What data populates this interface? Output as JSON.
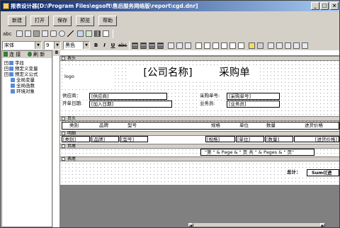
{
  "window": {
    "title": "报表设计器[D:\\Program Files\\egsoft\\售后服务网络版\\report\\cgd.dnr]",
    "min_label": "_",
    "max_label": "□",
    "close_label": "×"
  },
  "toolbar": {
    "new": "新建",
    "open": "打开",
    "save": "保存",
    "preview": "预览",
    "help": "帮助"
  },
  "format": {
    "font": "宋体",
    "size": "9",
    "color": "黑色",
    "bold": "B",
    "italic": "I",
    "underline": "U",
    "strike": "abc"
  },
  "left": {
    "tab_connect": "连 接",
    "tab_refresh": "刷 新",
    "tree": [
      {
        "label": "字段",
        "pm": "+"
      },
      {
        "label": "预定义变量",
        "pm": "+"
      },
      {
        "label": "预定义公式",
        "pm": "+"
      },
      {
        "label": "全局变量",
        "pm": ""
      },
      {
        "label": "全局函数",
        "pm": ""
      },
      {
        "label": "环境对象",
        "pm": ""
      }
    ]
  },
  "ruler": {
    "corner": "B"
  },
  "bands": {
    "title": "表头",
    "page_header": "页头",
    "detail": "明细",
    "page_footer": "页尾",
    "summary": "表尾"
  },
  "header": {
    "logo": "logo",
    "company": "[公司名称]",
    "doc_title": "采购单",
    "supplier_label": "供应商：",
    "supplier_value": "[供应商]",
    "date_label": "开单日期:",
    "date_value": "[加入日期]",
    "order_label": "采购单号:",
    "order_value": "[采购单号]",
    "staff_label": "业务员:",
    "staff_value": "[业务员]"
  },
  "columns": {
    "category": "类别",
    "brand": "品牌",
    "model": "型号",
    "spec": "规格",
    "unit": "单位",
    "qty": "数量",
    "price": "进货价格"
  },
  "detail": {
    "category": "[类别]",
    "brand": "[品牌]",
    "model": "[型号]",
    "spec": "[规格]",
    "unit": "[单位]",
    "qty": "[数量]",
    "price": "[进货价格]"
  },
  "footer": {
    "page_text": "\"第 \" & Page & \" 页   共 \" & Pages & \" 页\""
  },
  "summary": {
    "total_label": "总计：",
    "total_value": "Sum([进"
  }
}
